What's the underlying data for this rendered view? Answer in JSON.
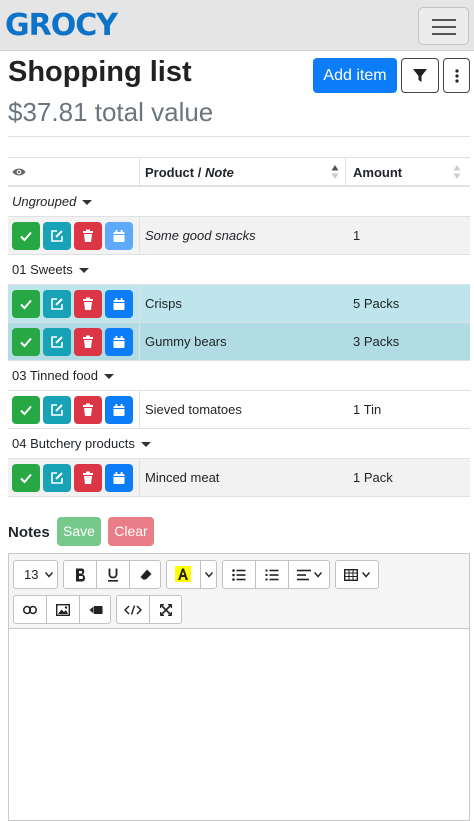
{
  "app": {
    "logo_text": "GROCY"
  },
  "header": {
    "title": "Shopping list",
    "total_value": "$37.81 total value",
    "add_item_label": "Add item"
  },
  "table": {
    "columns": {
      "product": "Product / ",
      "product_note": "Note",
      "amount": "Amount"
    },
    "groups": [
      {
        "name": "Ungrouped",
        "italic": true,
        "items": [
          {
            "name": "Some good snacks",
            "amount": "1",
            "is_note": true
          }
        ]
      },
      {
        "name": "01 Sweets",
        "items": [
          {
            "name": "Crisps",
            "amount": "5 Packs"
          },
          {
            "name": "Gummy bears",
            "amount": "3 Packs"
          }
        ]
      },
      {
        "name": "03 Tinned food",
        "items": [
          {
            "name": "Sieved tomatoes",
            "amount": "1 Tin"
          }
        ]
      },
      {
        "name": "04 Butchery products",
        "items": [
          {
            "name": "Minced meat",
            "amount": "1 Pack"
          }
        ]
      }
    ]
  },
  "notes": {
    "label": "Notes",
    "save_label": "Save",
    "clear_label": "Clear",
    "font_size": "13"
  },
  "colors": {
    "primary": "#0d7df7",
    "success": "#28a745",
    "info": "#17a2b8",
    "danger": "#dc3545",
    "row_highlight": "#bee5eb"
  },
  "icons": [
    "eye-icon",
    "check-icon",
    "edit-icon",
    "trash-icon",
    "calendar-icon",
    "filter-icon",
    "more-vertical-icon",
    "hamburger-icon"
  ]
}
